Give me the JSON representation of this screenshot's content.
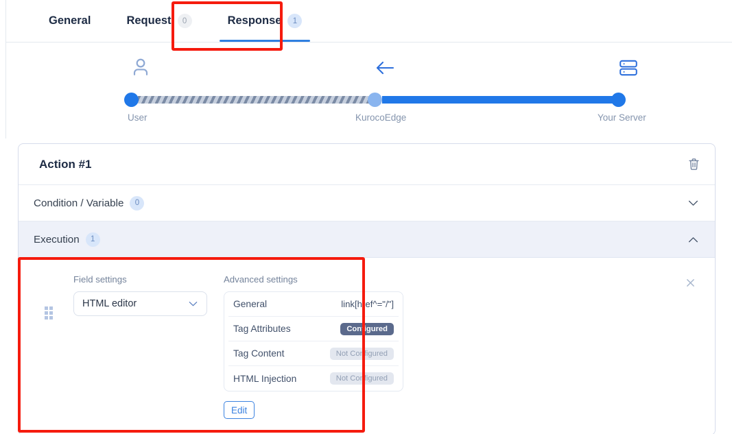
{
  "tabs": [
    {
      "label": "General",
      "badge": null,
      "active": false
    },
    {
      "label": "Request",
      "badge": "0",
      "active": false
    },
    {
      "label": "Response",
      "badge": "1",
      "active": true
    }
  ],
  "flow": {
    "nodes": [
      {
        "label": "User",
        "icon": "user-icon"
      },
      {
        "label": "KurocoEdge",
        "icon": "arrow-left-icon"
      },
      {
        "label": "Your Server",
        "icon": "server-icon"
      }
    ]
  },
  "action_card": {
    "title": "Action #1",
    "delete_icon": "trash-icon",
    "sections": [
      {
        "label": "Condition / Variable",
        "badge": "0",
        "expanded": false,
        "chevron": "chevron-down-icon"
      },
      {
        "label": "Execution",
        "badge": "1",
        "expanded": true,
        "chevron": "chevron-up-icon"
      }
    ]
  },
  "execution": {
    "field_settings": {
      "label": "Field settings",
      "select_value": "HTML editor"
    },
    "advanced_settings": {
      "label": "Advanced settings",
      "rows": [
        {
          "name": "General",
          "value": "link[href^=\"/\"]",
          "type": "text"
        },
        {
          "name": "Tag Attributes",
          "value": "Configured",
          "type": "pill-on"
        },
        {
          "name": "Tag Content",
          "value": "Not Configured",
          "type": "pill-off"
        },
        {
          "name": "HTML Injection",
          "value": "Not Configured",
          "type": "pill-off"
        }
      ],
      "edit_label": "Edit"
    },
    "remove_icon": "close-icon"
  },
  "colors": {
    "accent_blue": "#2078e8",
    "annotation_red": "#f51b0e",
    "pill_configured_bg": "#5b6a8c",
    "pill_not_configured_bg": "#e3e7ef",
    "execution_header_bg": "#eef1f9",
    "dot_mid": "#8ab5ef"
  }
}
